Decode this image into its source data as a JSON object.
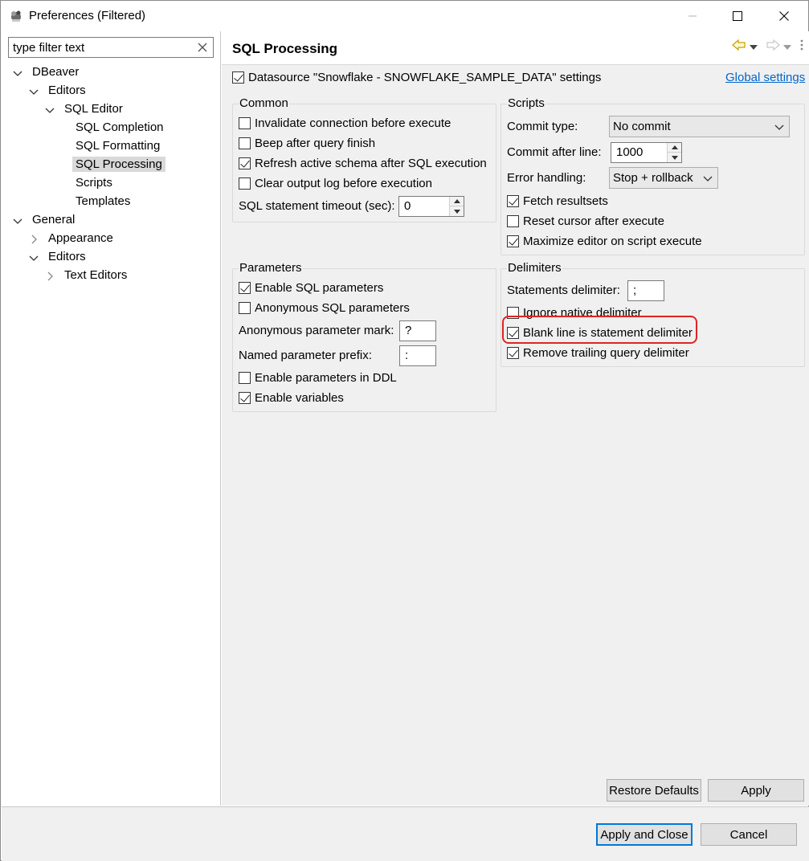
{
  "window": {
    "title": "Preferences (Filtered)"
  },
  "filter": {
    "placeholder": "type filter text",
    "value": "type filter text"
  },
  "tree": [
    {
      "label": "DBeaver",
      "expanded": true
    },
    {
      "label": "Editors",
      "expanded": true
    },
    {
      "label": "SQL Editor",
      "expanded": true
    },
    {
      "label": "SQL Completion"
    },
    {
      "label": "SQL Formatting"
    },
    {
      "label": "SQL Processing",
      "selected": true
    },
    {
      "label": "Scripts"
    },
    {
      "label": "Templates"
    },
    {
      "label": "General",
      "expanded": true
    },
    {
      "label": "Appearance",
      "expanded": false
    },
    {
      "label": "Editors",
      "expanded": true
    },
    {
      "label": "Text Editors",
      "expanded": false
    }
  ],
  "page": {
    "title": "SQL Processing",
    "datasource_label": "Datasource \"Snowflake - SNOWFLAKE_SAMPLE_DATA\" settings",
    "global_settings": "Global settings"
  },
  "common": {
    "title": "Common",
    "invalidate": "Invalidate connection before execute",
    "beep": "Beep after query finish",
    "refresh_schema": "Refresh active schema after SQL execution",
    "clear_log": "Clear output log before execution",
    "timeout_label": "SQL statement timeout (sec):",
    "timeout_value": "0"
  },
  "scripts": {
    "title": "Scripts",
    "commit_type_label": "Commit type:",
    "commit_type_value": "No commit",
    "commit_after_label": "Commit after line:",
    "commit_after_value": "1000",
    "error_handling_label": "Error handling:",
    "error_handling_value": "Stop + rollback",
    "fetch_resultsets": "Fetch resultsets",
    "reset_cursor": "Reset cursor after execute",
    "maximize_editor": "Maximize editor on script execute"
  },
  "parameters": {
    "title": "Parameters",
    "enable_sql_params": "Enable SQL parameters",
    "anonymous_params": "Anonymous SQL parameters",
    "anon_mark_label": "Anonymous parameter mark:",
    "anon_mark_value": "?",
    "named_prefix_label": "Named parameter prefix:",
    "named_prefix_value": ":",
    "enable_ddl": "Enable parameters in DDL",
    "enable_variables": "Enable variables"
  },
  "delimiters": {
    "title": "Delimiters",
    "statements_delimiter_label": "Statements delimiter:",
    "statements_delimiter_value": ";",
    "ignore_native": "Ignore native delimiter",
    "blank_line": "Blank line is statement delimiter",
    "remove_trailing": "Remove trailing query delimiter"
  },
  "buttons": {
    "restore_defaults": "Restore Defaults",
    "apply": "Apply",
    "apply_and_close": "Apply and Close",
    "cancel": "Cancel"
  },
  "colors": {
    "accent": "#0078d7",
    "link": "#0066cc",
    "highlight": "#e02424"
  }
}
